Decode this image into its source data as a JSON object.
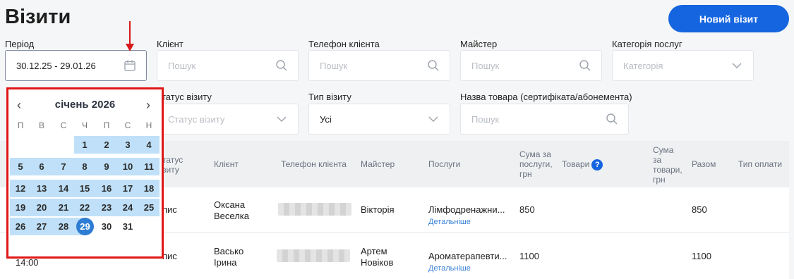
{
  "title": "Візити",
  "new_visit_label": "Новий візит",
  "filters": {
    "period": {
      "label": "Період",
      "value": "30.12.25 - 29.01.26"
    },
    "client": {
      "label": "Клієнт",
      "placeholder": "Пошук"
    },
    "phone": {
      "label": "Телефон клієнта",
      "placeholder": "Пошук"
    },
    "master": {
      "label": "Майстер",
      "placeholder": "Пошук"
    },
    "category": {
      "label": "Категорія послуг",
      "placeholder": "Категорія"
    },
    "status": {
      "label": "татус візиту",
      "placeholder": "Статус візиту"
    },
    "visit_type": {
      "label": "Тип візиту",
      "value": "Усі"
    },
    "product": {
      "label": "Назва товара (сертифіката/абонемента)",
      "placeholder": "Пошук"
    }
  },
  "calendar": {
    "month": "січень 2026",
    "weekdays": [
      "П",
      "В",
      "С",
      "Ч",
      "П",
      "С",
      "Н"
    ],
    "days": [
      "1",
      "2",
      "3",
      "4",
      "5",
      "6",
      "7",
      "8",
      "9",
      "10",
      "11",
      "12",
      "13",
      "14",
      "15",
      "16",
      "17",
      "18",
      "19",
      "20",
      "21",
      "22",
      "23",
      "24",
      "25",
      "26",
      "27",
      "28",
      "29",
      "30",
      "31"
    ],
    "selected": "29",
    "accent": "#2f7dd3",
    "range_color": "#bfe0f8"
  },
  "table": {
    "headers": {
      "status": "татус\nзиту",
      "client": "Клієнт",
      "phone": "Телефон клієнта",
      "master": "Майстер",
      "services": "Послуги",
      "services_sum": "Сума за\nпослуги,\nгрн",
      "products": "Товари",
      "products_sum": "Сума\nза\nтовари,\nгрн",
      "total": "Разом",
      "payment": "Тип оплати"
    },
    "rows": [
      {
        "status": "пис",
        "client": "Оксана\nВеселка",
        "master": "Вікторія",
        "service": "Лімфодренажни...",
        "details": "Детальніше",
        "services_sum": "850",
        "total": "850"
      },
      {
        "time": "14:00",
        "status": "пис",
        "client": "Васько\nІрина",
        "master": "Артем\nНовіков",
        "service": "Ароматерапевти...",
        "details": "Детальніше",
        "services_sum": "1100",
        "total": "1100"
      }
    ]
  },
  "colors": {
    "primary": "#1565e0",
    "annotation": "#e11616"
  }
}
